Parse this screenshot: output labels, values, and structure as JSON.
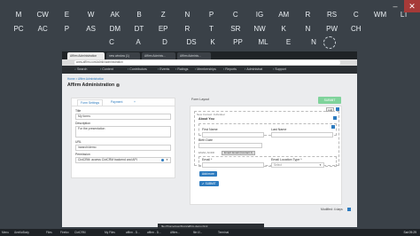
{
  "keyboard": {
    "row1": [
      "M",
      "CW",
      "E",
      "W",
      "AK",
      "B",
      "Z",
      "N",
      "P",
      "C",
      "IG",
      "AM",
      "R",
      "RS",
      "C",
      "WM",
      "LT"
    ],
    "row2": [
      "PC",
      "AC",
      "P",
      "AS",
      "DM",
      "DT",
      "EP",
      "R",
      "T",
      "SR",
      "NW",
      "K",
      "N",
      "PW",
      "CH"
    ],
    "row3": [
      "C",
      "A",
      "D",
      "DS",
      "K",
      "PP",
      "ML",
      "E",
      "N"
    ],
    "close": "✕",
    "min": "–"
  },
  "browser": {
    "tabs": [
      "Affirm Administration",
      "new window (1)",
      "Affirm Adminis...",
      "Affirm Adminis..."
    ],
    "url": "www.affirm.com/admin/administration"
  },
  "app_nav": [
    "Search",
    "Content",
    "Contributors",
    "Events",
    "Ratings",
    "Memberships",
    "Reports",
    "Administrat",
    "Support"
  ],
  "page": {
    "breadcrumb": "Home > Affirm Administration",
    "title": "Affirm Administration"
  },
  "left_panel": {
    "tabs": [
      "Form Settings",
      "Payment",
      "+"
    ],
    "title_label": "Title",
    "title_value": "My forms",
    "desc_label": "Description",
    "desc_value": "For the presentation",
    "url_label": "URL",
    "url_value": "/search/demo",
    "perm_label": "Permission",
    "perm_value": "CiviCRM: access CiviCRM backend and API"
  },
  "form_layout": {
    "label": "Form Layout",
    "submit_button": "SUBMIT",
    "add": "Add",
    "tag_name": "New Contact: Individual",
    "about_you": "About You",
    "first_name_lbl": "First Name",
    "last_name_lbl": "Last Name",
    "birth_lbl": "Birth Date",
    "email_group": "EMAIL ADDR",
    "email_lbl": "Email *",
    "email_loc_lbl": "Email Location Type *",
    "select_placeholder": "Select",
    "drag_label": "Email: Email (Contact 1)",
    "add_email_btn": "Add more",
    "submit_btn": "SUBMIT",
    "footer": "Modified: 4 days"
  },
  "taskbar": {
    "items": [
      "Menu",
      "iAmNoBody",
      "Files",
      "Firefox",
      "CiviCRM",
      "My Files",
      "affirm - D...",
      "affirm - D...",
      "Affirm...",
      "file:///...",
      "Terminal"
    ],
    "clock": "Sat 09:29"
  },
  "notification": "file:///home/user/Docs/affirm-demo.html",
  "colors": {
    "accent": "#2d7bbf",
    "green": "#7fd39b",
    "keyboard_bg": "#3a4148"
  }
}
